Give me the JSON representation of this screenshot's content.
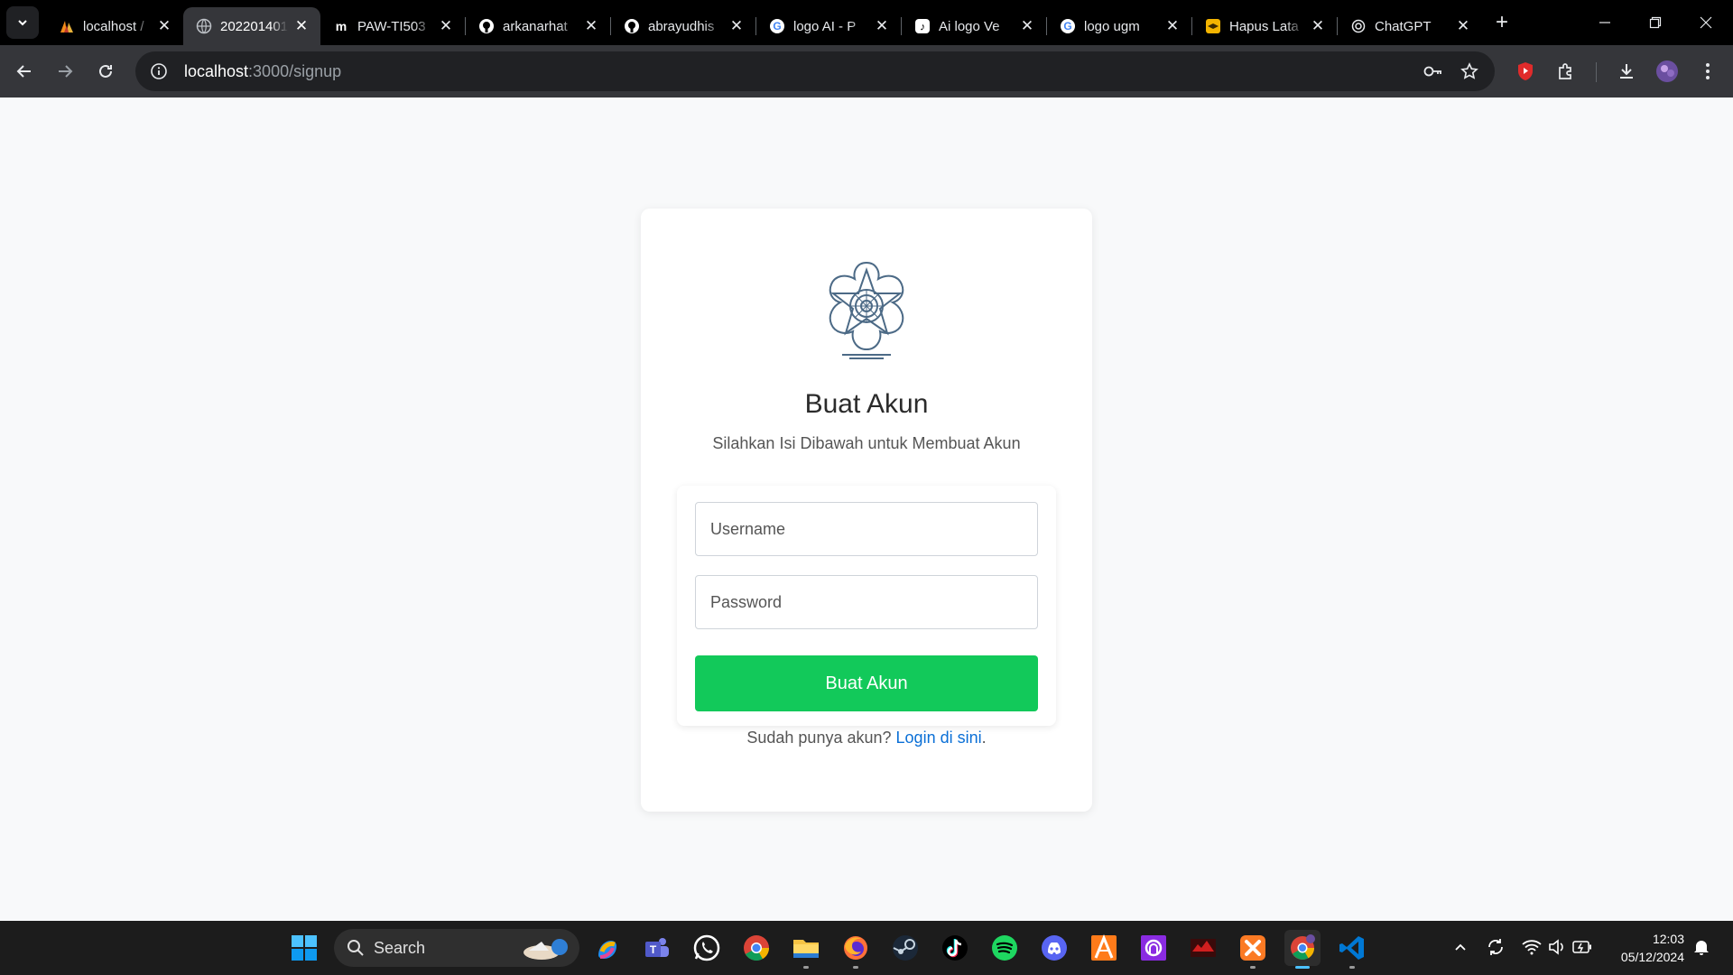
{
  "browser": {
    "tabs": [
      {
        "title": "localhost /",
        "icon": "xampp-sail-icon",
        "active": false
      },
      {
        "title": "202201401",
        "icon": "globe-icon",
        "active": true
      },
      {
        "title": "PAW-TI503",
        "icon": "tm-icon",
        "active": false
      },
      {
        "title": "arkanarhat",
        "icon": "github-icon",
        "active": false
      },
      {
        "title": "abrayudhis",
        "icon": "github-icon",
        "active": false
      },
      {
        "title": "logo AI - P",
        "icon": "google-icon",
        "active": false
      },
      {
        "title": "Ai logo Ve",
        "icon": "tiktok-icon",
        "active": false
      },
      {
        "title": "logo ugm",
        "icon": "google-icon",
        "active": false
      },
      {
        "title": "Hapus Lata",
        "icon": "hat-icon",
        "active": false
      },
      {
        "title": "ChatGPT",
        "icon": "openai-icon",
        "active": false
      }
    ],
    "url_host": "localhost",
    "url_path": ":3000/signup"
  },
  "page": {
    "title": "Buat Akun",
    "subtitle": "Silahkan Isi Dibawah untuk Membuat Akun",
    "username_placeholder": "Username",
    "password_placeholder": "Password",
    "submit_label": "Buat Akun",
    "login_prompt": "Sudah punya akun?",
    "login_link": "Login di sini",
    "login_suffix": ".",
    "accent_color": "#12c95a",
    "link_color": "#0a6fd6"
  },
  "taskbar": {
    "search_label": "Search",
    "time": "12:03",
    "date": "05/12/2024"
  }
}
